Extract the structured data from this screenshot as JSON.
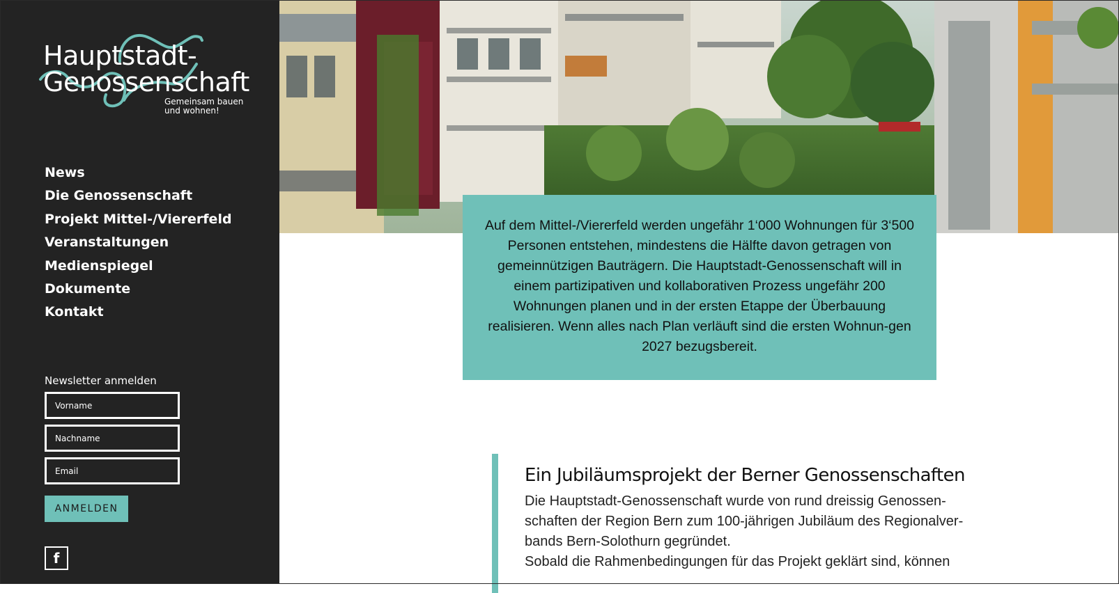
{
  "brand": {
    "line1": "Hauptstadt-",
    "line2": "Genossenschaft",
    "tagline_1": "Gemeinsam bauen",
    "tagline_2": "und wohnen!",
    "accent_color": "#6fc0b8",
    "sidebar_color": "#232323"
  },
  "nav": {
    "items": [
      {
        "label": "News"
      },
      {
        "label": "Die Genossenschaft"
      },
      {
        "label": "Projekt Mittel-/Viererfeld"
      },
      {
        "label": "Veranstaltungen"
      },
      {
        "label": "Medienspiegel"
      },
      {
        "label": "Dokumente"
      },
      {
        "label": "Kontakt"
      }
    ]
  },
  "newsletter": {
    "title": "Newsletter anmelden",
    "first_name_placeholder": "Vorname",
    "last_name_placeholder": "Nachname",
    "email_placeholder": "Email",
    "submit_label": "ANMELDEN"
  },
  "social": {
    "facebook_icon": "facebook-icon",
    "facebook_glyph": "f"
  },
  "intro": {
    "text": "Auf dem Mittel-/Viererfeld werden ungefähr 1‘000 Wohnungen für 3‘500 Personen entstehen, mindestens die Hälfte davon getragen von gemeinnützigen Bauträgern. Die Hauptstadt-Genossenschaft will in einem partizipativen und kollaborativen Prozess ungefähr 200 Wohnungen planen und in der ersten Etappe der Überbauung realisieren. Wenn alles nach Plan verläuft sind die ersten Wohnun-gen 2027 bezugsbereit."
  },
  "article": {
    "heading": "Ein Jubiläumsprojekt der Berner Genossenschaften",
    "paragraph_1": "Die Hauptstadt-Genossenschaft  wurde  von rund dreissig Genossen-schaften der Region Bern zum 100-jährigen Jubiläum des Regionalver-bands Bern-Solothurn gegründet.",
    "paragraph_2": "Sobald die Rahmenbedingungen für das Projekt geklärt sind, können"
  }
}
